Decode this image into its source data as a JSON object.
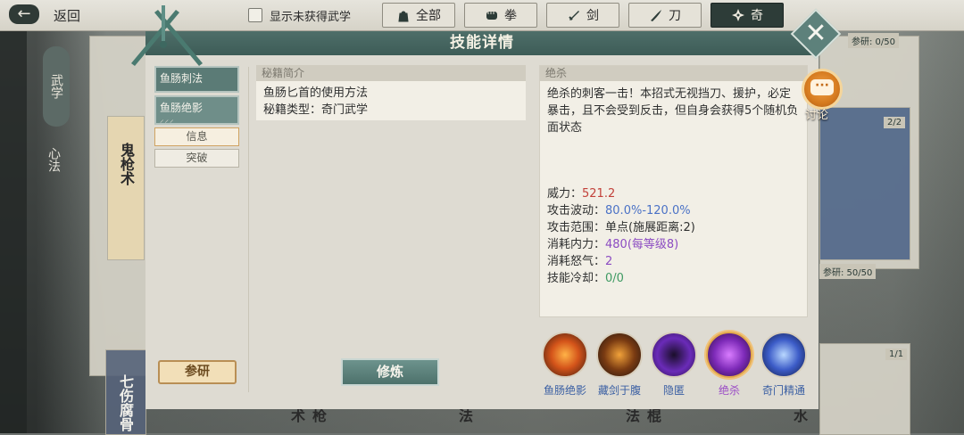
{
  "topbar": {
    "back_label": "返回",
    "show_unowned_label": "显示未获得武学",
    "filters": [
      {
        "label": "全部",
        "icon": "bag-icon",
        "active": false
      },
      {
        "label": "拳",
        "icon": "fist-icon",
        "active": false
      },
      {
        "label": "剑",
        "icon": "sword-icon",
        "active": false
      },
      {
        "label": "刀",
        "icon": "blade-icon",
        "active": false
      },
      {
        "label": "奇",
        "icon": "shuriken-icon",
        "active": true
      }
    ]
  },
  "background": {
    "side_banner": "武学",
    "side_text": "心法",
    "card_texts": [
      "鬼枪术",
      "七伤腐骨",
      "枪术",
      "法",
      "棍法",
      "水"
    ],
    "badges": [
      "参研: 0/50",
      "2/2",
      "参研: 50/50",
      "1/1"
    ]
  },
  "dialog": {
    "title": "技能详情",
    "subnav": [
      {
        "label": "鱼肠刺法",
        "marks": ""
      },
      {
        "label": "鱼肠绝影",
        "marks": "⸝⸝⸝"
      }
    ],
    "tabs": [
      "信息",
      "突破"
    ],
    "book_intro": {
      "heading": "秘籍简介",
      "line1": "鱼肠匕首的使用方法",
      "line2": "秘籍类型：奇门武学"
    },
    "study_button": "参研",
    "practice_button": "修炼",
    "detail": {
      "heading": "绝杀",
      "description": "绝杀的刺客一击！本招式无视挡刀、援护，必定暴击，且不会受到反击，但自身会获得5个随机负面状态",
      "stats": [
        {
          "label": "威力：",
          "value": "521.2",
          "color": "red"
        },
        {
          "label": "攻击波动：",
          "value": "80.0%-120.0%",
          "color": "blue"
        },
        {
          "label": "攻击范围：",
          "value": "单点(施展距离:2)",
          "color": "plain"
        },
        {
          "label": "消耗内力：",
          "value": "480",
          "suffix": "(每等级8)",
          "color": "purple"
        },
        {
          "label": "消耗怒气：",
          "value": "2",
          "color": "purple"
        },
        {
          "label": "技能冷却：",
          "value": "0/0",
          "color": "green"
        }
      ]
    },
    "skills": [
      {
        "name": "鱼肠绝影",
        "selected": false
      },
      {
        "name": "藏剑于腹",
        "selected": false
      },
      {
        "name": "隐匿",
        "selected": false
      },
      {
        "name": "绝杀",
        "selected": true
      },
      {
        "name": "奇门精通",
        "selected": false
      }
    ],
    "discuss_label": "讨论"
  }
}
